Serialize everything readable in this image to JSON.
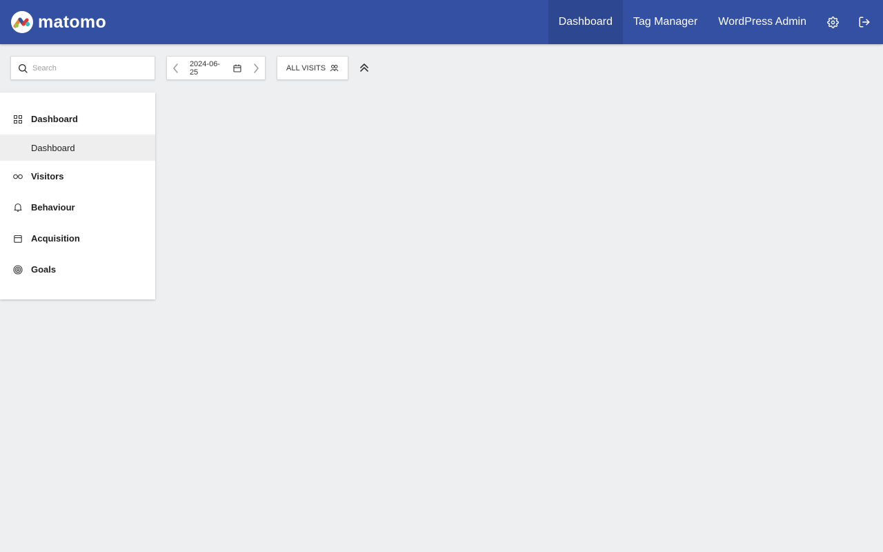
{
  "brand": {
    "name": "matomo"
  },
  "topnav": {
    "items": [
      {
        "label": "Dashboard",
        "active": true
      },
      {
        "label": "Tag Manager",
        "active": false
      },
      {
        "label": "WordPress Admin",
        "active": false
      }
    ],
    "icons": [
      "gear-icon",
      "logout-icon"
    ]
  },
  "search": {
    "placeholder": "Search",
    "value": ""
  },
  "period": {
    "date": "2024-06-25"
  },
  "segment": {
    "label": "ALL VISITS"
  },
  "sidebar": {
    "categories": [
      {
        "label": "Dashboard",
        "icon": "grid-icon",
        "sub": [
          {
            "label": "Dashboard"
          }
        ]
      },
      {
        "label": "Visitors",
        "icon": "binoculars-icon"
      },
      {
        "label": "Behaviour",
        "icon": "bell-icon"
      },
      {
        "label": "Acquisition",
        "icon": "calendar-icon"
      },
      {
        "label": "Goals",
        "icon": "target-icon"
      }
    ]
  },
  "colors": {
    "topbar": "#3450a3",
    "topbar_active": "#2d4790",
    "background": "#eeeff1"
  }
}
